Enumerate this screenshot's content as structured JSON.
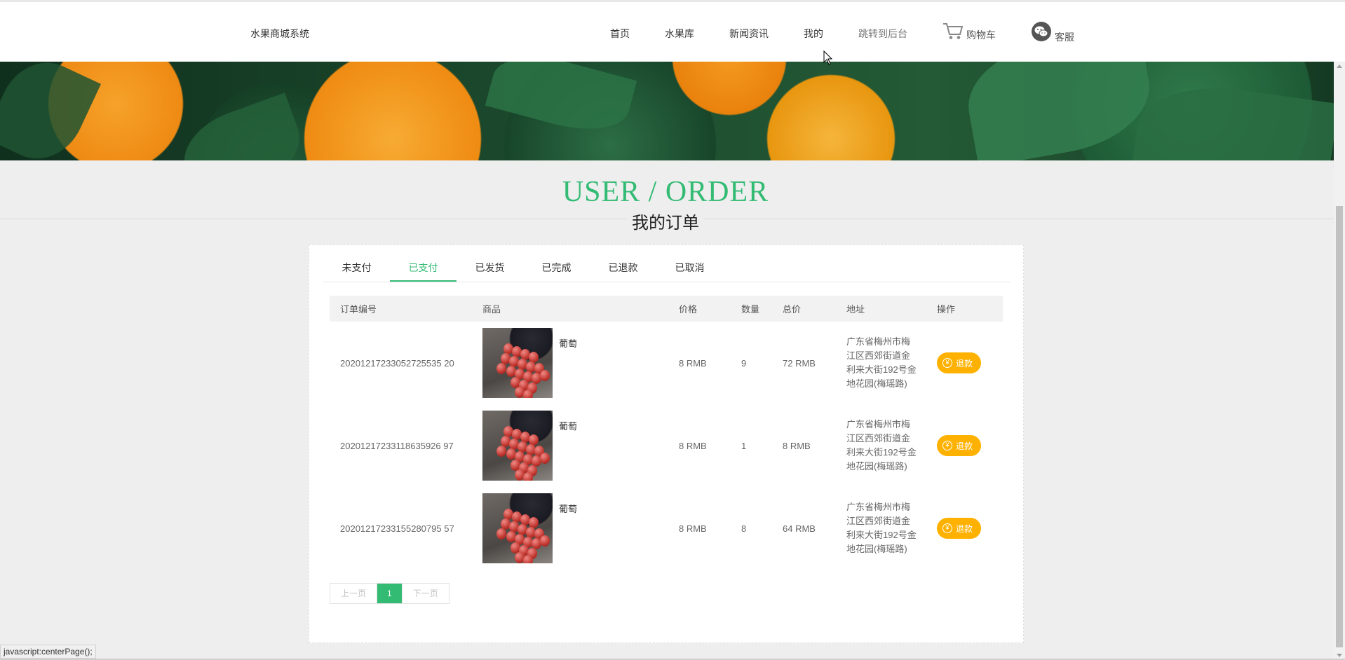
{
  "header": {
    "brand": "水果商城系统",
    "nav": [
      "首页",
      "水果库",
      "新闻资讯",
      "我的",
      "跳转到后台"
    ],
    "cart_label": "购物车",
    "service_label": "客服"
  },
  "title": {
    "en": "USER / ORDER",
    "cn": "我的订单"
  },
  "tabs": [
    {
      "label": "未支付",
      "active": false
    },
    {
      "label": "已支付",
      "active": true
    },
    {
      "label": "已发货",
      "active": false
    },
    {
      "label": "已完成",
      "active": false
    },
    {
      "label": "已退款",
      "active": false
    },
    {
      "label": "已取消",
      "active": false
    }
  ],
  "table": {
    "headers": [
      "订单编号",
      "商品",
      "价格",
      "数量",
      "总价",
      "地址",
      "操作"
    ],
    "rows": [
      {
        "order_no": "20201217233052725535 20",
        "product": "葡萄",
        "price": "8 RMB",
        "qty": "9",
        "total": "72 RMB",
        "address": "广东省梅州市梅江区西郊街道金利来大街192号金地花园(梅瑶路)",
        "action": "退款"
      },
      {
        "order_no": "20201217233118635926 97",
        "product": "葡萄",
        "price": "8 RMB",
        "qty": "1",
        "total": "8 RMB",
        "address": "广东省梅州市梅江区西郊街道金利来大街192号金地花园(梅瑶路)",
        "action": "退款"
      },
      {
        "order_no": "20201217233155280795 57",
        "product": "葡萄",
        "price": "8 RMB",
        "qty": "8",
        "total": "64 RMB",
        "address": "广东省梅州市梅江区西郊街道金利来大街192号金地花园(梅瑶路)",
        "action": "退款"
      }
    ]
  },
  "pager": {
    "prev": "上一页",
    "current": "1",
    "next": "下一页"
  },
  "status_bar": "javascript:centerPage();",
  "colors": {
    "accent": "#33bb74",
    "refund": "#ffb100"
  }
}
